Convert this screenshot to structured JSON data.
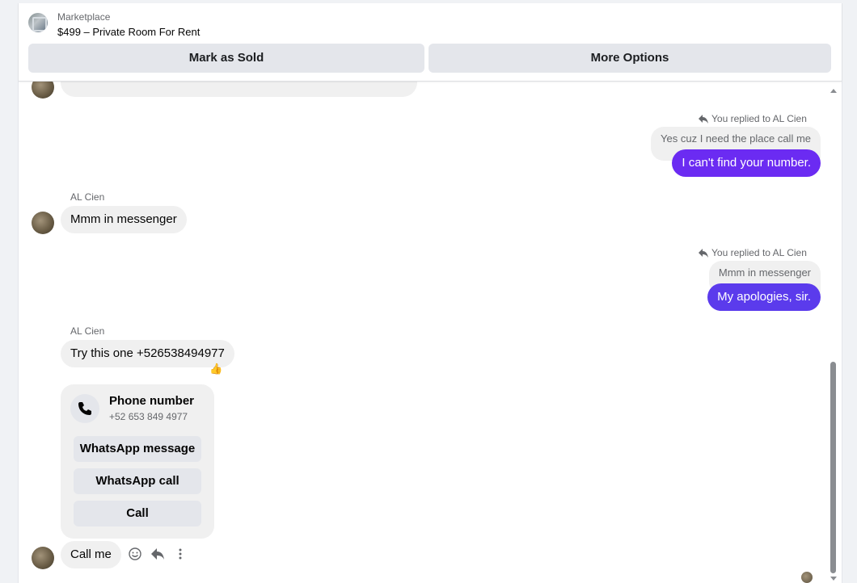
{
  "header": {
    "section": "Marketplace",
    "listing": "$499 – Private Room For Rent",
    "mark_sold": "Mark as Sold",
    "more_options": "More Options"
  },
  "messages": [
    {
      "replied_label": "You replied to AL Cien",
      "quoted": "Yes cuz I need the place call me",
      "text": "I can't find your number."
    },
    {
      "sender": "AL Cien",
      "text": "Mmm in messenger"
    },
    {
      "replied_label": "You replied to AL Cien",
      "quoted": "Mmm in messenger",
      "text": "My apologies, sir."
    },
    {
      "sender": "AL Cien",
      "text": "Try this one +526538494977",
      "reaction": "👍"
    },
    {
      "card": {
        "title": "Phone number",
        "number": "+52 653 849 4977",
        "buttons": [
          "WhatsApp message",
          "WhatsApp call",
          "Call"
        ]
      }
    },
    {
      "text": "Call me"
    }
  ],
  "colors": {
    "sent_bubble": "#6b2bf2",
    "received_bubble": "#f0f0f0",
    "button_gray": "#e4e6eb"
  }
}
